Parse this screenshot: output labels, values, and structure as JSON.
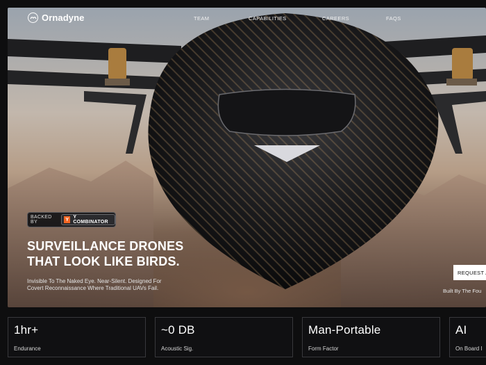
{
  "nav": {
    "brand": "Ornadyne",
    "links": [
      "TEAM",
      "CAPABILITIES",
      "CAREERS",
      "FAQS"
    ]
  },
  "hero": {
    "backed_by_label": "BACKED BY",
    "yc_badge": "Y",
    "backer": "Y COMBINATOR",
    "headline_line1": "SURVEILLANCE DRONES",
    "headline_line2": "THAT LOOK LIKE BIRDS.",
    "subline_line1": "Invisible To The Naked Eye. Near-Silent. Designed For",
    "subline_line2": "Covert Reconnaissance Where Traditional UAVs Fail.",
    "cta_label": "REQUEST A",
    "built_by": "Built By The Fou"
  },
  "stats": [
    {
      "value": "1hr+",
      "label": "Endurance"
    },
    {
      "value": "~0 DB",
      "label": "Acoustic Sig."
    },
    {
      "value": "Man-Portable",
      "label": "Form Factor"
    },
    {
      "value": "AI",
      "label": "On Board I"
    }
  ],
  "colors": {
    "page_bg": "#0e0e0f",
    "accent_yc": "#f26522",
    "card_border": "#38383c"
  }
}
